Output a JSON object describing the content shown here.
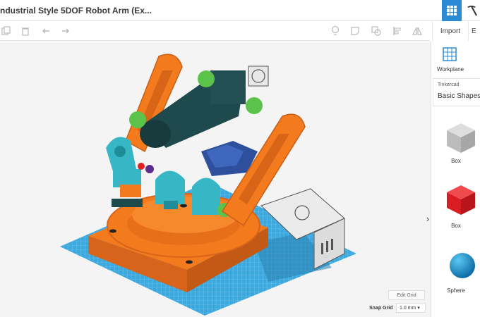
{
  "header": {
    "title": "ndustrial Style 5DOF Robot Arm (Ex...",
    "import_label": "Import",
    "export_label": "E"
  },
  "toolbar": {
    "tools": [
      "copy-icon",
      "delete-icon",
      "undo-icon",
      "redo-icon",
      "light-icon",
      "note-icon",
      "group-icon",
      "align-icon",
      "mirror-icon"
    ]
  },
  "sidebar": {
    "workplane_label": "Workplane",
    "library_label": "Tinkercad",
    "library_value": "Basic Shapes",
    "shapes": [
      {
        "name": "Box",
        "color": "#c8c8c8"
      },
      {
        "name": "Box",
        "color": "#e8252a"
      },
      {
        "name": "Sphere",
        "color": "#1e8bc3"
      }
    ]
  },
  "footer": {
    "edit_grid": "Edit Grid",
    "snap_label": "Snap Grid",
    "snap_value": "1.0 mm ▾"
  },
  "colors": {
    "accent": "#2a8ad4",
    "orange": "#f07a1c",
    "teal": "#38b8c8",
    "dark_teal": "#1f4a4d",
    "green": "#5bc24a",
    "grid_blue": "#37a6dd"
  }
}
